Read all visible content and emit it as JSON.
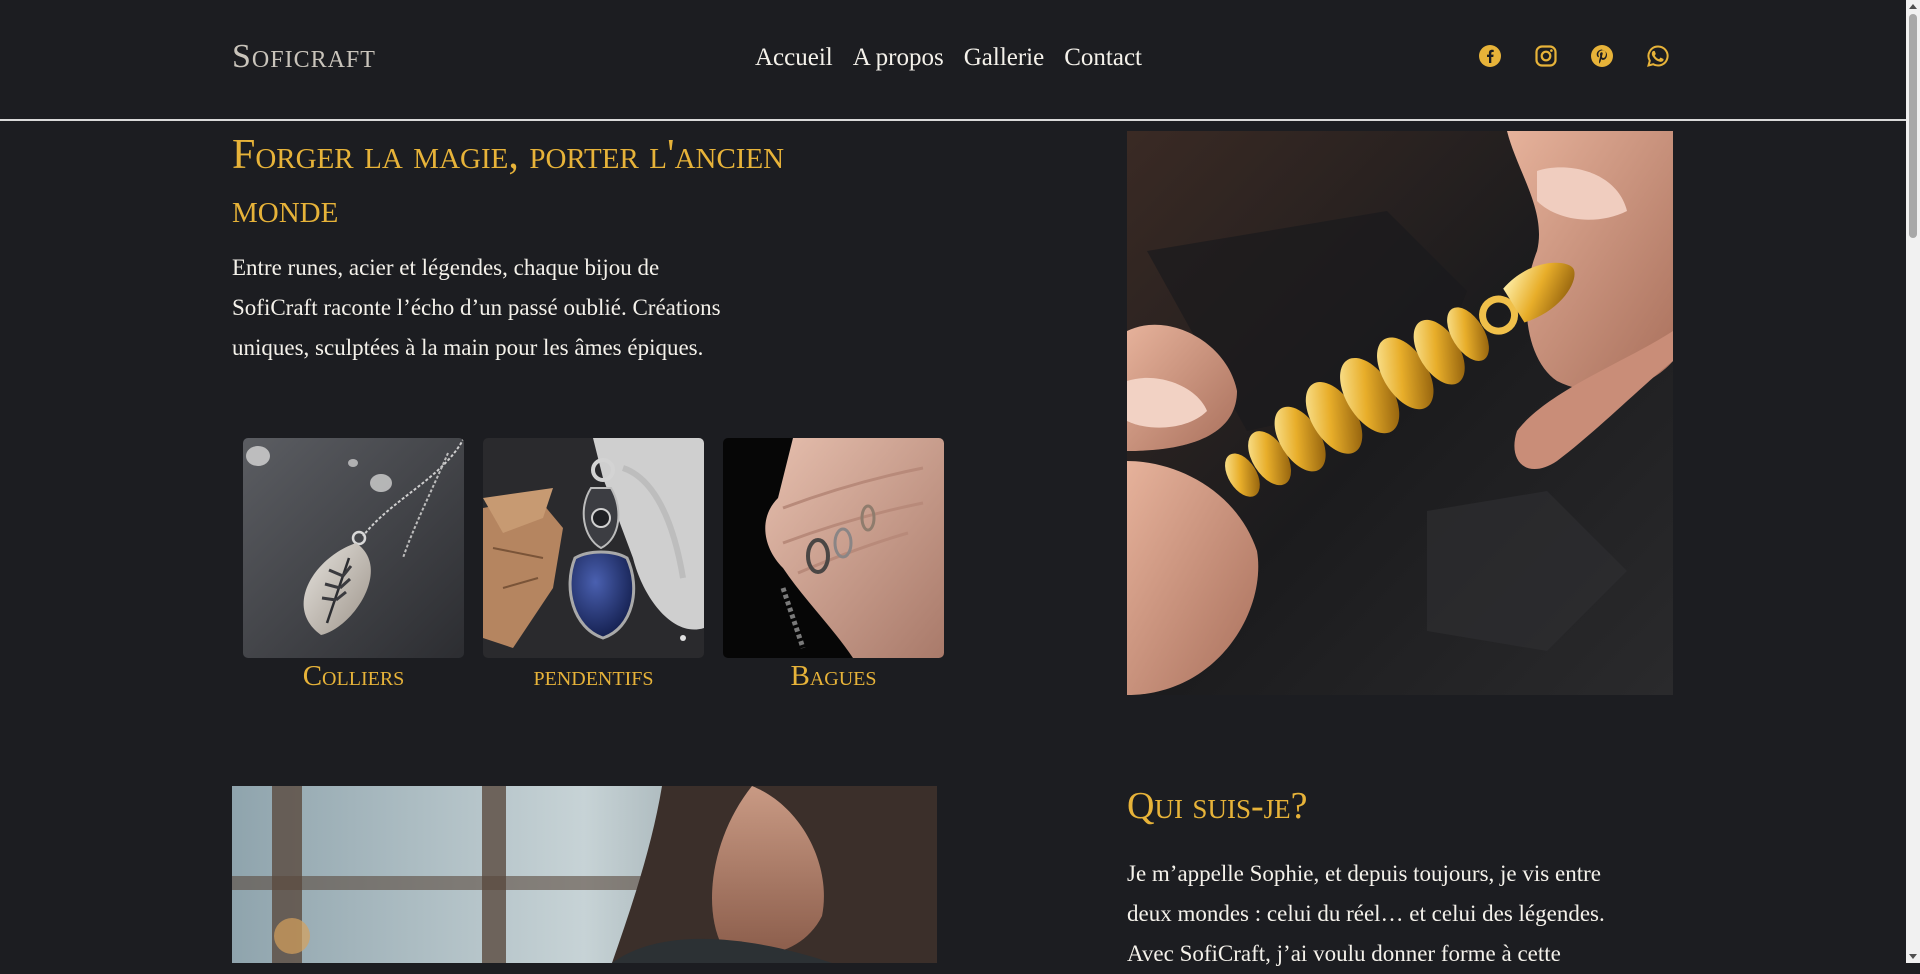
{
  "header": {
    "logo": "Soficraft",
    "nav": [
      "Accueil",
      "A propos",
      "Gallerie",
      "Contact"
    ]
  },
  "socials": [
    "facebook-icon",
    "instagram-icon",
    "pinterest-icon",
    "whatsapp-icon"
  ],
  "hero": {
    "title": "Forger la magie, porter l'ancien monde",
    "text": "Entre runes, acier et légendes, chaque bijou de SofiCraft raconte l’écho d’un passé oublié. Créations uniques, sculptées à la main pour les âmes épiques."
  },
  "categories": [
    {
      "label": "Colliers"
    },
    {
      "label": "pendentifs"
    },
    {
      "label": "Bagues"
    }
  ],
  "about": {
    "title": "Qui suis-je?",
    "text": "Je m’appelle Sophie, et depuis toujours, je vis entre deux mondes : celui du réel… et celui des légendes. Avec SofiCraft, j’ai voulu donner forme à cette"
  },
  "colors": {
    "background": "#1c1d21",
    "accent": "#e7b339",
    "text": "#f4f1ea"
  }
}
